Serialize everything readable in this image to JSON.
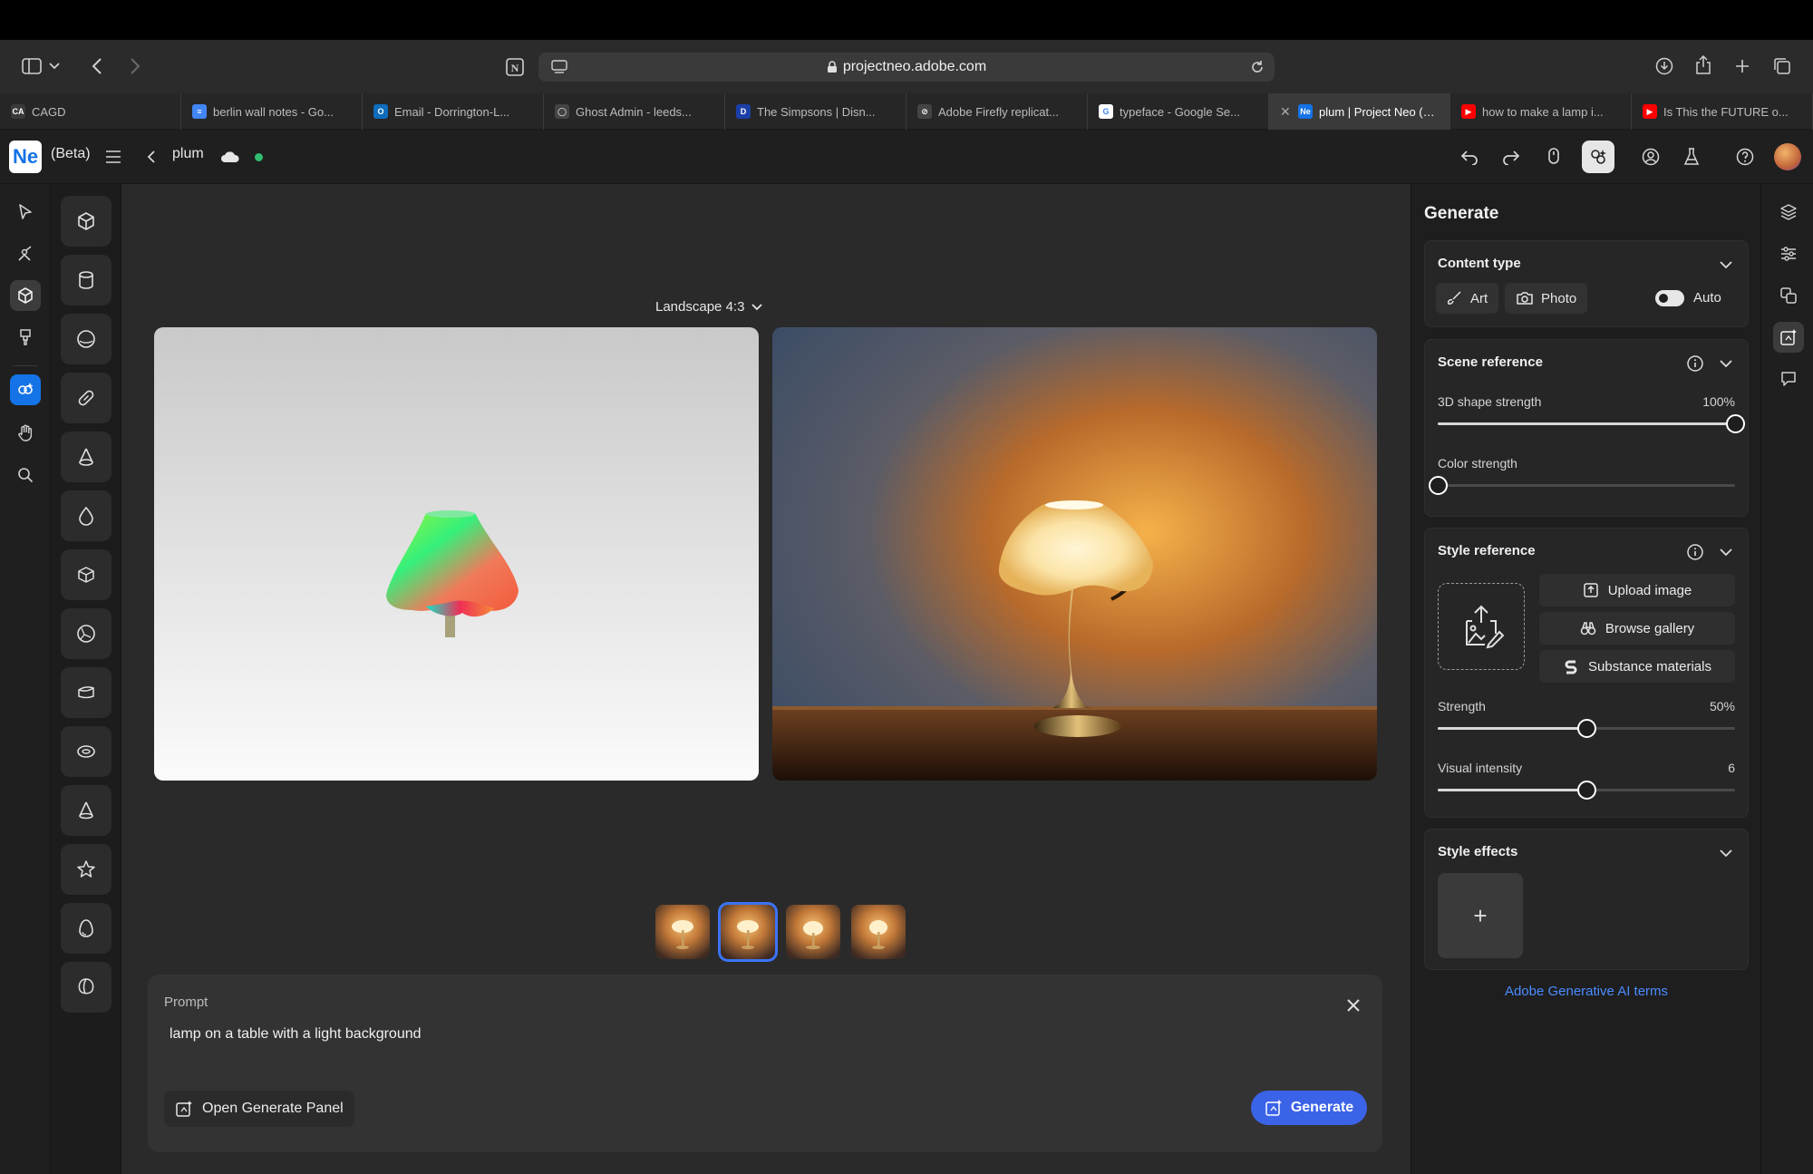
{
  "browser": {
    "url": "projectneo.adobe.com",
    "tabs": [
      {
        "label": "CAGD",
        "favicon_color": "#3a3a3a",
        "favicon": "CA"
      },
      {
        "label": "berlin wall notes - Go...",
        "favicon_color": "#4285f4",
        "favicon": "≡"
      },
      {
        "label": "Email - Dorrington-L...",
        "favicon_color": "#0f6cbd",
        "favicon": "O"
      },
      {
        "label": "Ghost Admin - leeds...",
        "favicon_color": "#444444",
        "favicon": "◯"
      },
      {
        "label": "The Simpsons | Disn...",
        "favicon_color": "#1b3fa8",
        "favicon": "D"
      },
      {
        "label": "Adobe Firefly replicat...",
        "favicon_color": "#444444",
        "favicon": "⊘"
      },
      {
        "label": "typeface - Google Se...",
        "favicon_color": "#ffffff",
        "favicon": "G"
      },
      {
        "label": "plum | Project Neo (B...",
        "favicon_color": "#1473e6",
        "favicon": "Ne",
        "active": true
      },
      {
        "label": "how to make a lamp i...",
        "favicon_color": "#ff0000",
        "favicon": "▶"
      },
      {
        "label": "Is This the FUTURE o...",
        "favicon_color": "#ff0000",
        "favicon": "▶"
      }
    ]
  },
  "app": {
    "logo": "Ne",
    "beta_label": "(Beta)",
    "project_name": "plum",
    "status_color": "#2fbf71"
  },
  "canvas": {
    "aspect_label": "Landscape 4:3",
    "selected_thumbnail": 1,
    "thumbnail_count": 4
  },
  "prompt": {
    "label": "Prompt",
    "text": "lamp on a table with a light background",
    "open_panel_label": "Open Generate Panel",
    "generate_label": "Generate"
  },
  "panel": {
    "title": "Generate",
    "content_type": {
      "title": "Content type",
      "art_label": "Art",
      "photo_label": "Photo",
      "auto_label": "Auto",
      "auto_on": true
    },
    "scene_reference": {
      "title": "Scene reference",
      "shape_label": "3D shape strength",
      "shape_value": "100%",
      "shape_fraction": 1.0,
      "color_label": "Color strength",
      "color_fraction": 0.0
    },
    "style_reference": {
      "title": "Style reference",
      "upload_label": "Upload image",
      "browse_label": "Browse gallery",
      "substance_label": "Substance materials",
      "strength_label": "Strength",
      "strength_value": "50%",
      "strength_fraction": 0.5,
      "intensity_label": "Visual intensity",
      "intensity_value": "6",
      "intensity_fraction": 0.5
    },
    "style_effects": {
      "title": "Style effects",
      "add_label": "+"
    },
    "terms_link": "Adobe Generative AI terms"
  },
  "colors": {
    "accent": "#3b63e8",
    "link": "#4a8cff"
  }
}
